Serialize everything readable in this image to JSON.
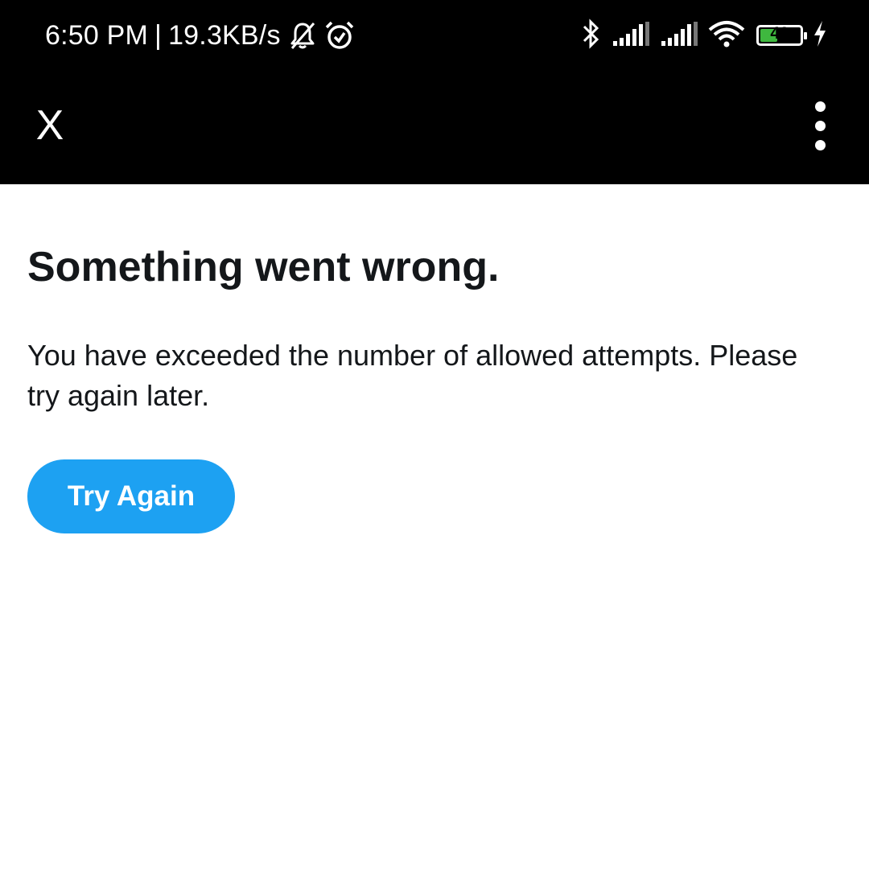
{
  "status_bar": {
    "time": "6:50 PM",
    "separator": "|",
    "network_speed": "19.3KB/s",
    "icons": [
      "muted-bell-icon",
      "alarm-icon",
      "bluetooth-icon",
      "signal-icon",
      "signal-icon",
      "wifi-icon",
      "battery-icon",
      "charging-icon"
    ],
    "battery_level": "43",
    "battery_fraction": 0.43,
    "battery_color": "#3fb83f"
  },
  "app_bar": {
    "close_label": "X",
    "overflow_icon": "more-vert-icon",
    "background": "#000000"
  },
  "main": {
    "title": "Something went wrong.",
    "message": "You have exceeded the number of allowed attempts. Please try again later.",
    "try_again_label": "Try Again",
    "accent_color": "#1da1f2"
  }
}
